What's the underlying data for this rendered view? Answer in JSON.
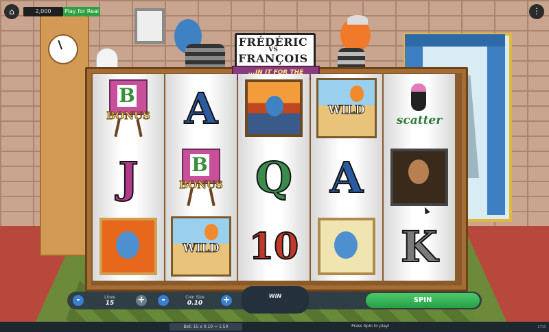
{
  "top_bar": {
    "home_icon": "home-icon",
    "balance": "2,000",
    "play_real_label": "Play for Real",
    "menu_icon": "more-vertical-icon"
  },
  "title": {
    "line1": "FRÉDÉRIC",
    "line2": "VS",
    "line3": "FRANÇOIS",
    "subtitle": "...IN IT FOR THE MONET!"
  },
  "reels": [
    {
      "cells": [
        {
          "type": "bonus",
          "text": "BONUS",
          "badge": "B"
        },
        {
          "type": "letter",
          "text": "J"
        },
        {
          "type": "portrait",
          "text": ""
        }
      ]
    },
    {
      "cells": [
        {
          "type": "letter",
          "text": "A"
        },
        {
          "type": "bonus",
          "text": "BONUS",
          "badge": "B"
        },
        {
          "type": "wild",
          "text": "WILD"
        }
      ]
    },
    {
      "cells": [
        {
          "type": "scream",
          "text": ""
        },
        {
          "type": "letter",
          "text": "Q"
        },
        {
          "type": "letter",
          "text": "10"
        }
      ]
    },
    {
      "cells": [
        {
          "type": "wild",
          "text": "WILD"
        },
        {
          "type": "letter",
          "text": "A"
        },
        {
          "type": "blue-face",
          "text": ""
        }
      ]
    },
    {
      "cells": [
        {
          "type": "scatter",
          "text": "scatter"
        },
        {
          "type": "mona",
          "text": ""
        },
        {
          "type": "letter",
          "text": "K"
        }
      ]
    }
  ],
  "controls": {
    "lines_label": "Lines",
    "lines_value": "15",
    "coin_label": "Coin Size",
    "coin_value": "0.10",
    "minus": "-",
    "plus": "+",
    "win_label": "WIN",
    "spin_label": "SPIN"
  },
  "footer": {
    "bet_info": "Bet: 15 x 0.10 = 1.50",
    "status": "Press Spin to play!",
    "version": "1715"
  },
  "colors": {
    "spin_green": "#27a045",
    "brick": "#c9a48f",
    "frame_wood": "#8b5a2b",
    "button_blue": "#3a7fd0"
  }
}
